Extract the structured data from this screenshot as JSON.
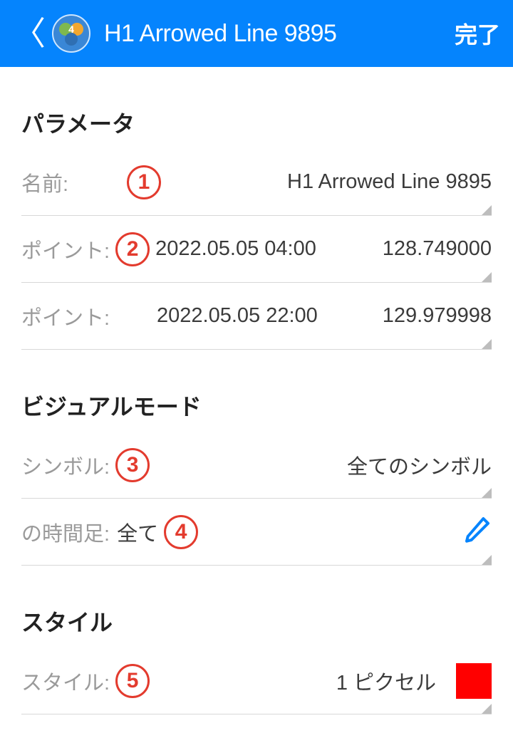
{
  "header": {
    "title": "H1 Arrowed Line 9895",
    "done": "完了"
  },
  "badges": {
    "b1": "1",
    "b2": "2",
    "b3": "3",
    "b4": "4",
    "b5": "5"
  },
  "sections": {
    "parameters": "パラメータ",
    "visual_mode": "ビジュアルモード",
    "style": "スタイル"
  },
  "rows": {
    "name": {
      "label": "名前:",
      "value": "H1 Arrowed Line 9895"
    },
    "point1": {
      "label": "ポイント:",
      "datetime": "2022.05.05 04:00",
      "price": "128.749000"
    },
    "point2": {
      "label": "ポイント:",
      "datetime": "2022.05.05 22:00",
      "price": "129.979998"
    },
    "symbol": {
      "label": "シンボル:",
      "value": "全てのシンボル"
    },
    "timeframe": {
      "label": "の時間足:",
      "value": "全て"
    },
    "style": {
      "label": "スタイル:",
      "value": "1 ピクセル",
      "color": "#ff0000"
    }
  }
}
